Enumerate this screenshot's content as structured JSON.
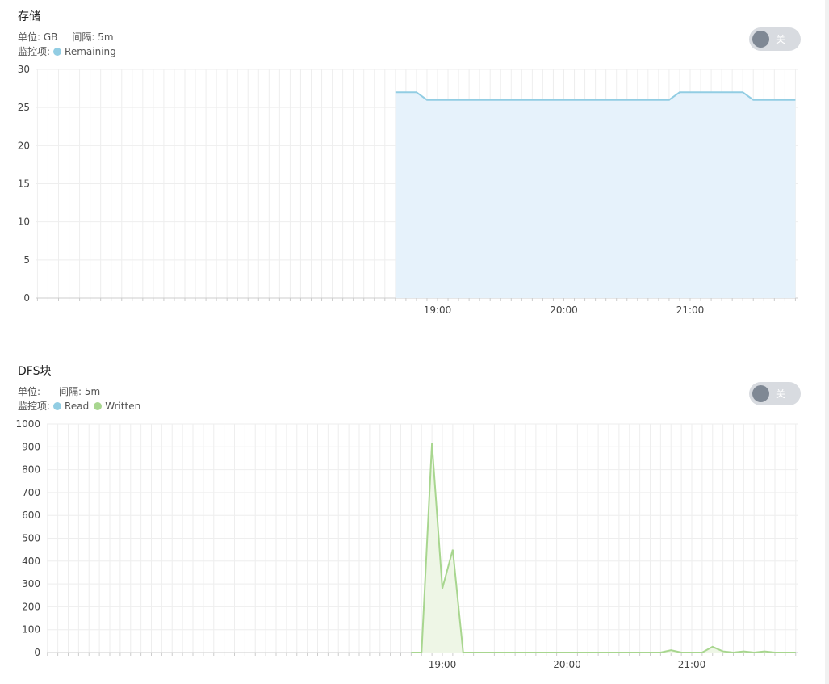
{
  "panels": [
    {
      "title": "存储",
      "unit_label": "单位: GB",
      "interval_label": "间隔: 5m",
      "monitor_label": "监控项:",
      "toggle_label": "关"
    },
    {
      "title": "DFS块",
      "unit_label": "单位:",
      "interval_label": "间隔: 5m",
      "monitor_label": "监控项:",
      "toggle_label": "关"
    }
  ],
  "chart_data": [
    {
      "type": "area",
      "title": "存储",
      "ylim": [
        0,
        30
      ],
      "yticks": [
        0,
        5,
        10,
        15,
        20,
        25,
        30
      ],
      "xlim": [
        "18:00",
        "21:50"
      ],
      "xticks": [
        "19:00",
        "20:00",
        "21:00"
      ],
      "grid": true,
      "series": [
        {
          "name": "Remaining",
          "color": "#92cde3",
          "fill": "#e6f2fb",
          "x": [
            "18:40",
            "18:45",
            "18:50",
            "18:55",
            "19:00",
            "19:05",
            "19:10",
            "19:15",
            "19:20",
            "19:25",
            "19:30",
            "19:35",
            "19:40",
            "19:45",
            "19:50",
            "19:55",
            "20:00",
            "20:05",
            "20:10",
            "20:15",
            "20:20",
            "20:25",
            "20:30",
            "20:35",
            "20:40",
            "20:45",
            "20:50",
            "20:55",
            "21:00",
            "21:05",
            "21:10",
            "21:15",
            "21:20",
            "21:25",
            "21:30",
            "21:35",
            "21:40",
            "21:45",
            "21:50"
          ],
          "values": [
            27,
            27,
            27,
            26,
            26,
            26,
            26,
            26,
            26,
            26,
            26,
            26,
            26,
            26,
            26,
            26,
            26,
            26,
            26,
            26,
            26,
            26,
            26,
            26,
            26,
            26,
            26,
            27,
            27,
            27,
            27,
            27,
            27,
            27,
            26,
            26,
            26,
            26,
            26
          ]
        }
      ]
    },
    {
      "type": "area",
      "title": "DFS块",
      "ylim": [
        0,
        1000
      ],
      "yticks": [
        0,
        100,
        200,
        300,
        400,
        500,
        600,
        700,
        800,
        900,
        1000
      ],
      "xlim": [
        "18:00",
        "21:50"
      ],
      "xticks": [
        "19:00",
        "20:00",
        "21:00"
      ],
      "grid": true,
      "series": [
        {
          "name": "Read",
          "color": "#92cde3",
          "fill": "none",
          "x": [
            "18:45",
            "18:50",
            "18:55",
            "19:00",
            "19:05",
            "19:10",
            "19:15",
            "19:20",
            "19:25",
            "19:30",
            "19:35",
            "19:40",
            "19:45",
            "19:50",
            "19:55",
            "20:00",
            "20:05",
            "20:10",
            "20:15",
            "20:20",
            "20:25",
            "20:30",
            "20:35",
            "20:40",
            "20:45",
            "20:50",
            "20:55",
            "21:00",
            "21:05",
            "21:10",
            "21:15",
            "21:20",
            "21:25",
            "21:30",
            "21:35",
            "21:40",
            "21:45",
            "21:50"
          ],
          "values": [
            0,
            0,
            5,
            5,
            0,
            0,
            0,
            0,
            0,
            0,
            0,
            0,
            0,
            0,
            0,
            0,
            0,
            0,
            0,
            0,
            0,
            0,
            0,
            0,
            0,
            0,
            0,
            0,
            0,
            0,
            0,
            0,
            0,
            0,
            0,
            0,
            0,
            0
          ]
        },
        {
          "name": "Written",
          "color": "#a8d68f",
          "fill": "#eef6e6",
          "x": [
            "18:45",
            "18:50",
            "18:55",
            "19:00",
            "19:05",
            "19:10",
            "19:15",
            "19:20",
            "19:25",
            "19:30",
            "19:35",
            "19:40",
            "19:45",
            "19:50",
            "19:55",
            "20:00",
            "20:05",
            "20:10",
            "20:15",
            "20:20",
            "20:25",
            "20:30",
            "20:35",
            "20:40",
            "20:45",
            "20:50",
            "20:55",
            "21:00",
            "21:05",
            "21:10",
            "21:15",
            "21:20",
            "21:25",
            "21:30",
            "21:35",
            "21:40",
            "21:45",
            "21:50"
          ],
          "values": [
            0,
            0,
            915,
            280,
            450,
            0,
            0,
            0,
            0,
            0,
            0,
            0,
            0,
            0,
            0,
            0,
            0,
            0,
            0,
            0,
            0,
            0,
            0,
            0,
            0,
            10,
            0,
            0,
            0,
            25,
            5,
            0,
            5,
            0,
            5,
            0,
            0,
            0
          ]
        }
      ]
    }
  ]
}
